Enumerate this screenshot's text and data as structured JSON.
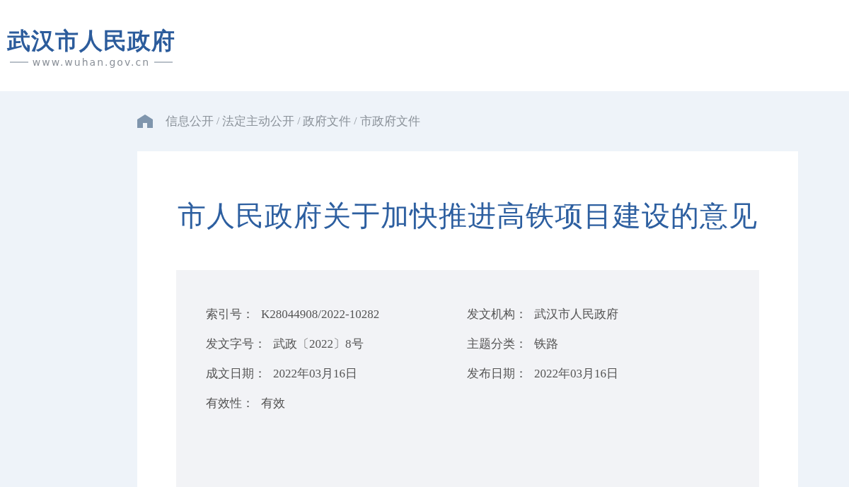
{
  "header": {
    "logo_title": "武汉市人民政府",
    "logo_url": "www.wuhan.gov.cn"
  },
  "breadcrumb": [
    {
      "kind": "link",
      "label": "信息公开"
    },
    {
      "kind": "separator",
      "label": "/"
    },
    {
      "kind": "link",
      "label": "法定主动公开"
    },
    {
      "kind": "separator",
      "label": "/"
    },
    {
      "kind": "link",
      "label": "政府文件"
    },
    {
      "kind": "separator",
      "label": "/"
    },
    {
      "kind": "link",
      "label": "市政府文件"
    }
  ],
  "article": {
    "title": "市人民政府关于加快推进高铁项目建设的意见",
    "meta": [
      {
        "label": "索引号：",
        "value": "K28044908/2022-10282"
      },
      {
        "label": "发文机构：",
        "value": "武汉市人民政府"
      },
      {
        "label": "发文字号：",
        "value": "武政〔2022〕8号"
      },
      {
        "label": "主题分类：",
        "value": "铁路"
      },
      {
        "label": "成文日期：",
        "value": "2022年03月16日"
      },
      {
        "label": "发布日期：",
        "value": "2022年03月16日"
      },
      {
        "label": "有效性：",
        "value": "有效"
      }
    ]
  }
}
